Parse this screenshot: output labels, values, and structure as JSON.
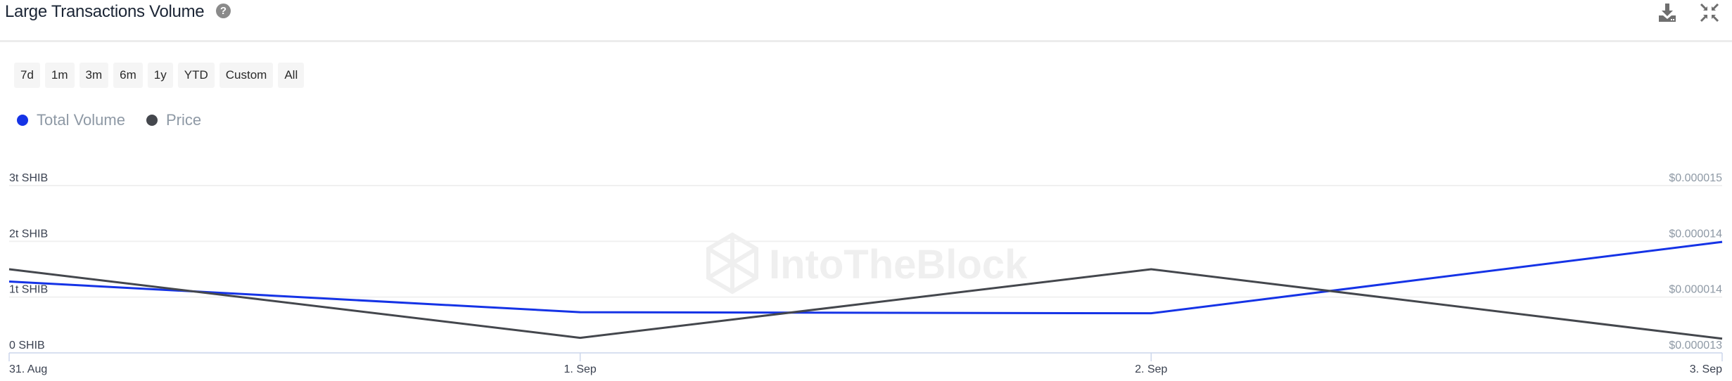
{
  "header": {
    "title": "Large Transactions Volume",
    "help_icon": "question-circle-icon",
    "download_icon": "download-icon",
    "collapse_icon": "collapse-arrows-icon"
  },
  "ranges": [
    "7d",
    "1m",
    "3m",
    "6m",
    "1y",
    "YTD",
    "Custom",
    "All"
  ],
  "legend": [
    {
      "label": "Total Volume",
      "color": "#1533e6"
    },
    {
      "label": "Price",
      "color": "#44474d"
    }
  ],
  "watermark": "IntoTheBlock",
  "chart_data": {
    "type": "line",
    "title": "Large Transactions Volume",
    "x": [
      "31. Aug",
      "1. Sep",
      "2. Sep",
      "3. Sep"
    ],
    "series": [
      {
        "name": "Total Volume",
        "axis": "left",
        "unit": "trillion SHIB",
        "color": "#1533e6",
        "values": [
          1.28,
          0.73,
          0.71,
          1.99
        ]
      },
      {
        "name": "Price",
        "axis": "right",
        "unit": "USD",
        "color": "#44474d",
        "values": [
          1.4e-05,
          1.318e-05,
          1.4e-05,
          1.317e-05
        ]
      }
    ],
    "y_left": {
      "ticks": [
        0,
        1,
        2,
        3
      ],
      "tick_labels": [
        "0 SHIB",
        "1t SHIB",
        "2t SHIB",
        "3t SHIB"
      ],
      "range": [
        0,
        3
      ]
    },
    "y_right": {
      "ticks": [
        1.3e-05,
        1.367e-05,
        1.433e-05,
        1.5e-05
      ],
      "tick_labels": [
        "$0.000013",
        "$0.000014",
        "$0.000014",
        "$0.000015"
      ],
      "range": [
        1.3e-05,
        1.5e-05
      ]
    },
    "grid": true,
    "legend_position": "top-left"
  }
}
